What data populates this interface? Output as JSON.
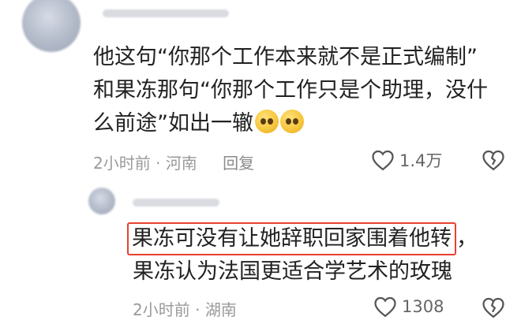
{
  "comments": [
    {
      "lines": [
        "他这句“你那个工作本来就不是正式编制”",
        "和果冻那句“你那个工作只是个助理，没什",
        "么前途”如出一辙"
      ],
      "time": "2小时前",
      "location": "河南",
      "reply_label": "回复",
      "likes": "1.4万",
      "emojis": [
        "pleading-face",
        "pleading-face"
      ]
    },
    {
      "highlighted": "果冻可没有让她辞职回家围着他转",
      "line1_tail": "，",
      "line2": "果冻认为法国更适合学艺术的玫瑰",
      "time": "2小时前",
      "location": "湖南",
      "likes": "1308"
    }
  ],
  "separator": " · ",
  "colors": {
    "highlight_border": "#e8402f",
    "meta": "#9a9a9a",
    "text": "#222222"
  }
}
